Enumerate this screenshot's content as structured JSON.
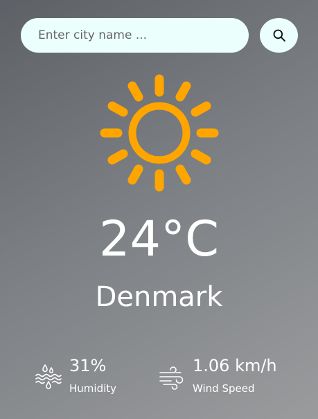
{
  "search": {
    "placeholder": "Enter city name ...",
    "button_icon": "search-icon"
  },
  "weather": {
    "icon": "sun-icon",
    "icon_color": "#ffa500",
    "temperature": "24°C",
    "city": "Denmark"
  },
  "details": {
    "humidity": {
      "icon": "humidity-icon",
      "value": "31%",
      "label": "Humidity"
    },
    "wind": {
      "icon": "wind-icon",
      "value": "1.06 km/h",
      "label": "Wind Speed"
    }
  },
  "colors": {
    "input_background": "#ebfffc",
    "text": "#ffffff",
    "background_top": "#5d6166",
    "background_bottom": "#9a9b9d"
  }
}
